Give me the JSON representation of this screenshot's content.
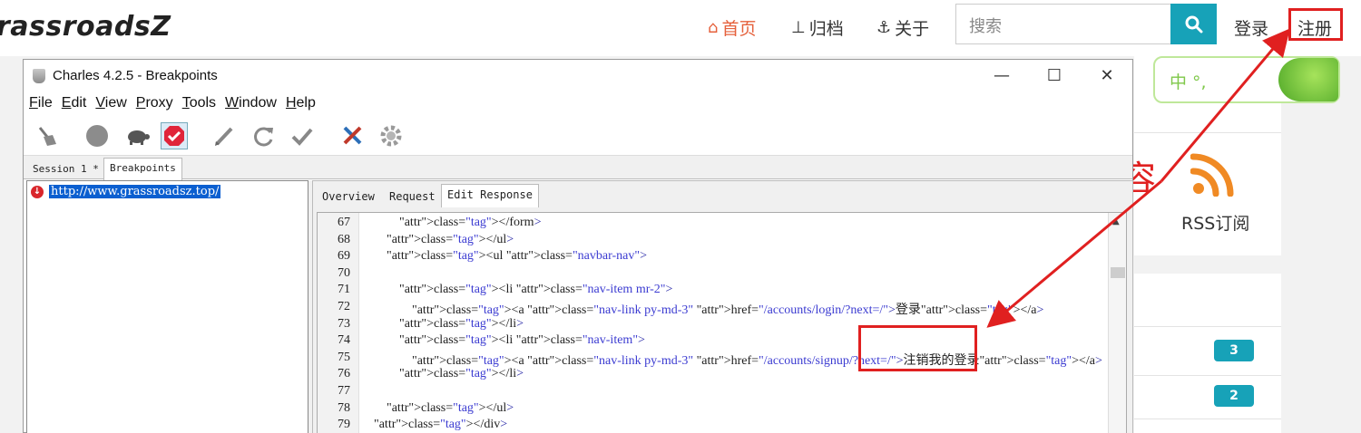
{
  "site": {
    "brand": "rassroadsZ",
    "nav": [
      {
        "icon": "home-icon",
        "glyph": "⌂",
        "label": "首页"
      },
      {
        "icon": "sitemap-icon",
        "glyph": "⊥",
        "label": "归档"
      },
      {
        "icon": "anchor-icon",
        "glyph": "⚓",
        "label": "关于"
      }
    ],
    "search_placeholder": "搜索",
    "login": "登录",
    "signup": "注册"
  },
  "sidebar": {
    "weather_text": "中 °,",
    "rss_label": "RSS订阅",
    "badges": [
      "3",
      "2"
    ]
  },
  "annotation": "更改内容",
  "charles": {
    "title": "Charles 4.2.5 - Breakpoints",
    "menu": [
      "File",
      "Edit",
      "View",
      "Proxy",
      "Tools",
      "Window",
      "Help"
    ],
    "session_tabs": [
      "Session 1 *",
      "Breakpoints"
    ],
    "breakpoint_url": "http://www.grassroadsz.top/",
    "detail_tabs": [
      "Overview",
      "Request",
      "Edit Response"
    ],
    "code_lines": [
      {
        "n": "67",
        "text": "            </form>"
      },
      {
        "n": "68",
        "text": "        </ul>"
      },
      {
        "n": "69",
        "text": "        <ul class=\"navbar-nav\">"
      },
      {
        "n": "70",
        "text": ""
      },
      {
        "n": "71",
        "text": "            <li class=\"nav-item mr-2\">"
      },
      {
        "n": "72",
        "text": "                <a class=\"nav-link py-md-3\" href=\"/accounts/login/?next=/\">登录</a>"
      },
      {
        "n": "73",
        "text": "            </li>"
      },
      {
        "n": "74",
        "text": "            <li class=\"nav-item\">"
      },
      {
        "n": "75",
        "text": "                <a class=\"nav-link py-md-3\" href=\"/accounts/signup/?next=/\">注销我的登录</a>"
      },
      {
        "n": "76",
        "text": "            </li>"
      },
      {
        "n": "77",
        "text": ""
      },
      {
        "n": "78",
        "text": "        </ul>"
      },
      {
        "n": "79",
        "text": "    </div>"
      }
    ]
  }
}
